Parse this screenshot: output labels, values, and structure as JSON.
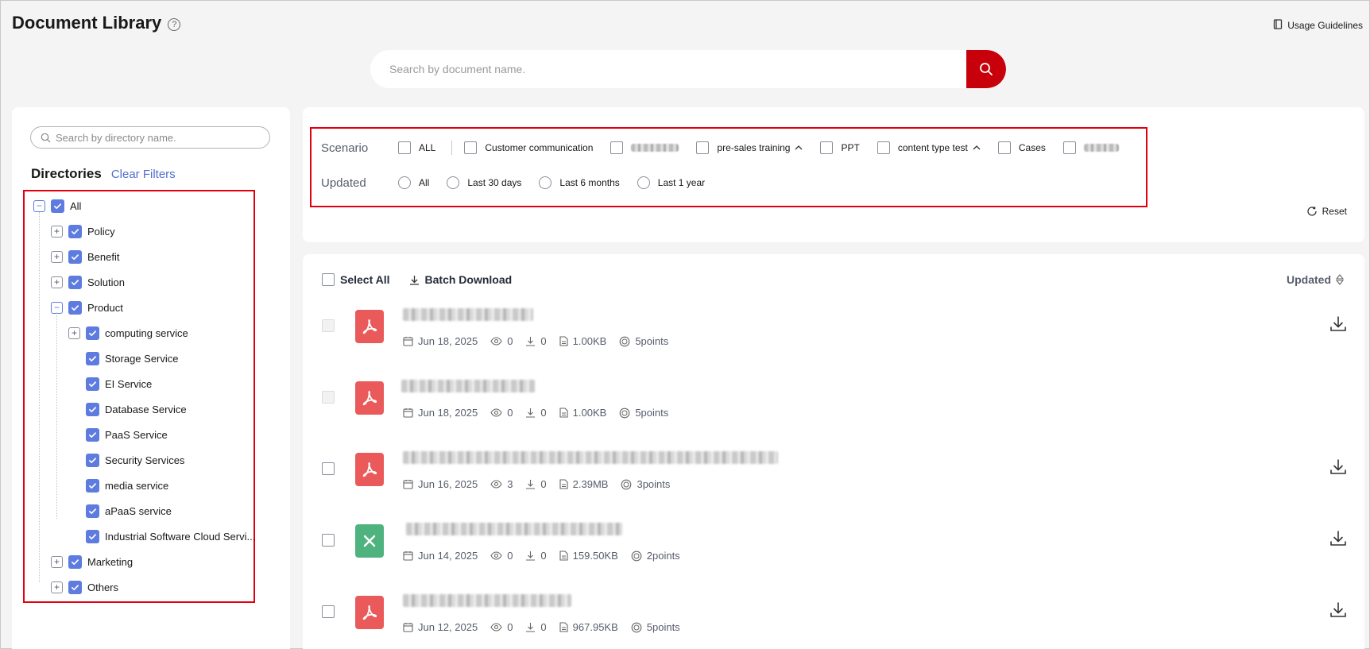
{
  "header": {
    "title": "Document Library",
    "help_icon": "?",
    "usage_guidelines": "Usage Guidelines"
  },
  "search": {
    "placeholder": "Search by document name."
  },
  "directory": {
    "search_placeholder": "Search by directory name.",
    "title": "Directories",
    "clear_filters": "Clear Filters",
    "tree": [
      {
        "label": "All",
        "checked": true,
        "expanded": true,
        "level": 0
      },
      {
        "label": "Policy",
        "checked": true,
        "expanded": false,
        "level": 1
      },
      {
        "label": "Benefit",
        "checked": true,
        "expanded": false,
        "level": 1
      },
      {
        "label": "Solution",
        "checked": true,
        "expanded": false,
        "level": 1
      },
      {
        "label": "Product",
        "checked": true,
        "expanded": true,
        "level": 1
      },
      {
        "label": "computing service",
        "checked": true,
        "expanded": false,
        "level": 2
      },
      {
        "label": "Storage Service",
        "checked": true,
        "level": 2
      },
      {
        "label": "EI Service",
        "checked": true,
        "level": 2
      },
      {
        "label": "Database Service",
        "checked": true,
        "level": 2
      },
      {
        "label": "PaaS Service",
        "checked": true,
        "level": 2
      },
      {
        "label": "Security Services",
        "checked": true,
        "level": 2
      },
      {
        "label": "media service",
        "checked": true,
        "level": 2
      },
      {
        "label": "aPaaS service",
        "checked": true,
        "level": 2
      },
      {
        "label": "Industrial Software Cloud Servi...",
        "checked": true,
        "level": 2
      },
      {
        "label": "Marketing",
        "checked": true,
        "expanded": false,
        "level": 1
      },
      {
        "label": "Others",
        "checked": true,
        "expanded": false,
        "level": 1
      }
    ]
  },
  "filters": {
    "scenario_label": "Scenario",
    "scenario_options": [
      {
        "label": "ALL",
        "checked": false
      },
      {
        "label": "Customer communication",
        "checked": false
      },
      {
        "label": "",
        "checked": false,
        "blurred": true
      },
      {
        "label": "pre-sales training",
        "checked": false,
        "has_chevron": true
      },
      {
        "label": "PPT",
        "checked": false
      },
      {
        "label": "content type test",
        "checked": false,
        "has_chevron": true
      },
      {
        "label": "Cases",
        "checked": false
      },
      {
        "label": "",
        "checked": false,
        "blurred": true
      }
    ],
    "updated_label": "Updated",
    "updated_options": [
      "All",
      "Last 30 days",
      "Last 6 months",
      "Last 1 year"
    ],
    "reset_label": "Reset"
  },
  "list": {
    "select_all": "Select All",
    "batch_download": "Batch Download",
    "sort_label": "Updated",
    "documents": [
      {
        "type": "pdf",
        "date": "Jun 18, 2025",
        "views": "0",
        "downloads": "0",
        "size": "1.00KB",
        "points": "5points",
        "selectable": false,
        "downloadable": true
      },
      {
        "type": "pdf",
        "date": "Jun 18, 2025",
        "views": "0",
        "downloads": "0",
        "size": "1.00KB",
        "points": "5points",
        "selectable": false,
        "downloadable": false
      },
      {
        "type": "pdf",
        "date": "Jun 16, 2025",
        "views": "3",
        "downloads": "0",
        "size": "2.39MB",
        "points": "3points",
        "selectable": true,
        "downloadable": true
      },
      {
        "type": "xls",
        "date": "Jun 14, 2025",
        "views": "0",
        "downloads": "0",
        "size": "159.50KB",
        "points": "2points",
        "selectable": true,
        "downloadable": true
      },
      {
        "type": "pdf",
        "date": "Jun 12, 2025",
        "views": "0",
        "downloads": "0",
        "size": "967.95KB",
        "points": "5points",
        "selectable": true,
        "downloadable": true
      }
    ]
  },
  "colors": {
    "accent_red": "#c7000b",
    "highlight_border": "#e0000f",
    "checkbox_blue": "#5e7ce0",
    "link_blue": "#526ecc",
    "pdf_red": "#ea5a5a",
    "excel_green": "#4fb37f"
  }
}
